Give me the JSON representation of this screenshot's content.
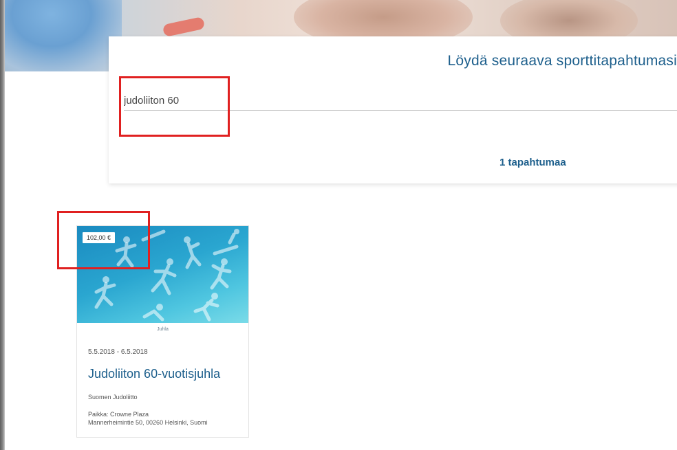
{
  "search": {
    "heading": "Löydä seuraava sporttitapahtumasi",
    "query": "judoliiton 60",
    "result_count": "1 tapahtumaa"
  },
  "events": [
    {
      "price": "102,00 €",
      "category": "Juhla",
      "dates": "5.5.2018 - 6.5.2018",
      "title": "Judoliiton 60-vuotisjuhla",
      "organizer": "Suomen Judoliitto",
      "venue_line1": "Paikka: Crowne Plaza",
      "venue_line2": "Mannerheimintie 50, 00260 Helsinki, Suomi"
    }
  ],
  "colors": {
    "accent": "#1d5f8c",
    "highlight": "#e02020",
    "image_bg": "#2aa6d0"
  }
}
